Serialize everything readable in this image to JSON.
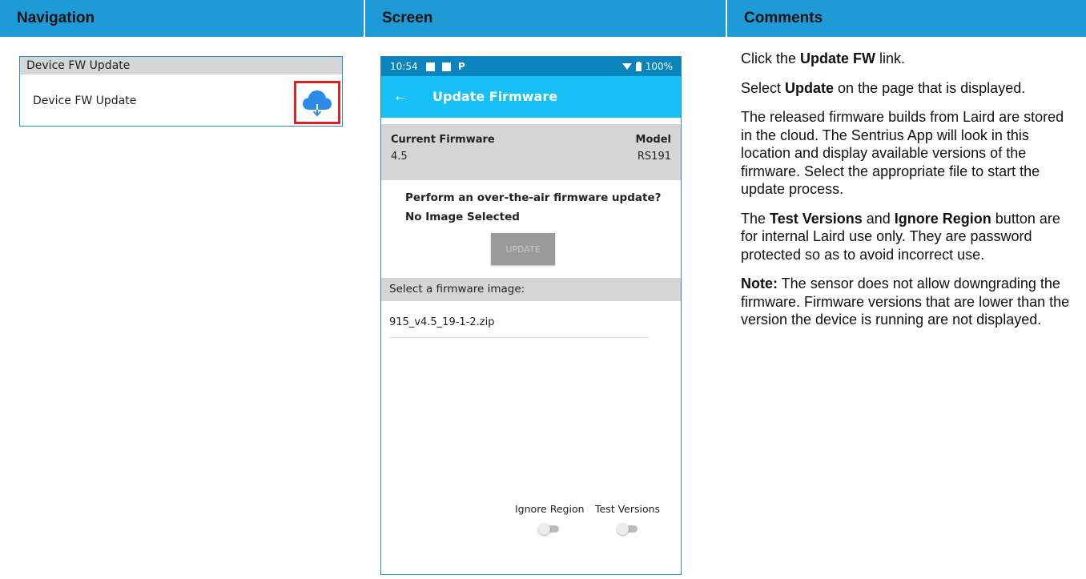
{
  "header": {
    "col1": "Navigation",
    "col2": "Screen",
    "col3": "Comments",
    "color": "#1d9bd6"
  },
  "navigation": {
    "section_title": "Device FW Update",
    "item_label": "Device FW Update",
    "icon": "cloud-download-icon",
    "highlight_color": "#e02020"
  },
  "phone": {
    "status": {
      "time": "10:54",
      "battery": "100%"
    },
    "appbar_title": "Update Firmware",
    "appbar_color": "#16c0f5",
    "current_firmware_label": "Current Firmware",
    "current_firmware_value": "4.5",
    "model_label": "Model",
    "model_value": "RS191",
    "question": "Perform an over-the-air firmware update?",
    "selection_status": "No Image Selected",
    "update_button": "UPDATE",
    "select_prompt": "Select a firmware image:",
    "files": [
      "915_v4.5_19-1-2.zip"
    ],
    "toggles": [
      {
        "label": "Ignore Region",
        "on": false
      },
      {
        "label": "Test Versions",
        "on": false
      }
    ]
  },
  "comments": {
    "p1_pre": "Click the ",
    "p1_bold": "Update FW",
    "p1_post": " link.",
    "p2_pre": "Select ",
    "p2_bold": "Update",
    "p2_post": " on the page that is displayed.",
    "p3": "The released firmware builds from Laird are stored in the cloud. The Sentrius App will look in this location and display available versions of the firmware. Select the appropriate file to start the update process.",
    "p4_pre": "The ",
    "p4_bold1": "Test Versions",
    "p4_mid": " and ",
    "p4_bold2": "Ignore Region",
    "p4_post": " button are for internal Laird use only. They are password protected so as to avoid incorrect use.",
    "p5_bold": "Note:",
    "p5_post": " The sensor does not allow downgrading the firmware. Firmware versions that are lower than the version the device is running are not displayed."
  }
}
